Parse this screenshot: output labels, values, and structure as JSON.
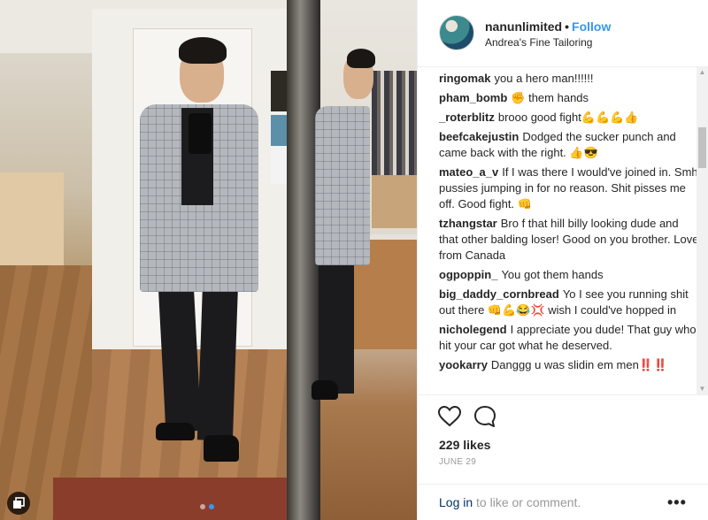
{
  "post": {
    "username": "nanunlimited",
    "separator": "•",
    "follow_label": "Follow",
    "location": "Andrea's Fine Tailoring"
  },
  "comments": [
    {
      "user": "ringomak",
      "text": "you a hero man!!!!!!"
    },
    {
      "user": "pham_bomb",
      "text": "✊ them hands"
    },
    {
      "user": "_roterblitz",
      "text": "brooo good fight💪💪💪👍"
    },
    {
      "user": "beefcakejustin",
      "text": "Dodged the sucker punch and came back with the right. 👍😎"
    },
    {
      "user": "mateo_a_v",
      "text": "If I was there I would've joined in. Smh pussies jumping in for no reason. Shit pisses me off. Good fight. 👊"
    },
    {
      "user": "tzhangstar",
      "text": "Bro f that hill billy looking dude and that other balding loser! Good on you brother. Love from Canada"
    },
    {
      "user": "ogpoppin_",
      "text": "You got them hands"
    },
    {
      "user": "big_daddy_cornbread",
      "text": "Yo I see you running shit out there 👊💪😂💢 wish I could've hopped in"
    },
    {
      "user": "nicholegend",
      "text": "I appreciate you dude! That guy who hit your car got what he deserved."
    },
    {
      "user": "yookarry",
      "text": "Danggg u was slidin em men‼️‼️"
    }
  ],
  "actions": {
    "likes": "229 likes",
    "date": "June 29",
    "login_link": "Log in",
    "login_rest": " to like or comment.",
    "more": "•••"
  },
  "icons": {
    "like": "heart-icon",
    "comment": "comment-icon",
    "multi_photo": "multiple-photos-icon",
    "more": "more-options-icon"
  },
  "colors": {
    "accent": "#3897f0",
    "link": "#003569",
    "muted": "#999999"
  }
}
